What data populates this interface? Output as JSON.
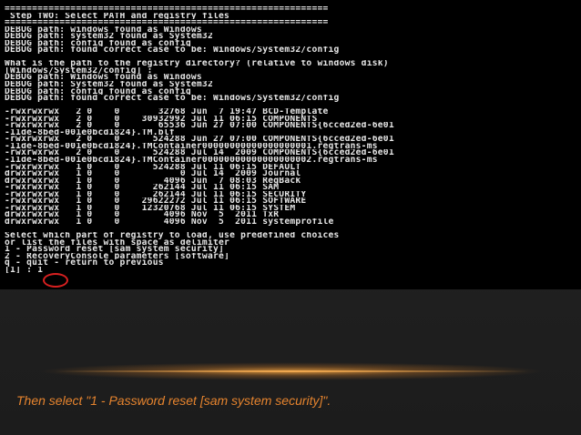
{
  "terminal": {
    "lines": [
      "===========================================================",
      " Step TWO: Select PATH and registry files",
      "===========================================================",
      "DEBUG path: windows found as Windows",
      "DEBUG path: system32 found as System32",
      "DEBUG path: config found as config",
      "DEBUG path: found correct case to be: Windows/System32/config",
      "",
      "What is the path to the registry directory? (relative to windows disk)",
      "[Windows/System32/config] :",
      "DEBUG path: Windows found as Windows",
      "DEBUG path: System32 found as System32",
      "DEBUG path: config found as config",
      "DEBUG path: found correct case to be: Windows/System32/config",
      "",
      "-rwxrwxrwx   2 0    0       32768 Jun  7 19:47 BCD-Template",
      "-rwxrwxrwx   2 0    0    30932992 Jul 11 06:15 COMPONENTS",
      "-rwxrwxrwx   2 0    0       65536 Jun 27 07:00 COMPONENTS{6cced2ed-6e01",
      "-11de-8bed-001e0bcd1824}.TM.blf",
      "-rwxrwxrwx   2 0    0      524288 Jun 27 07:00 COMPONENTS{6cced2ed-6e01",
      "-11de-8bed-001e0bcd1824}.TMContainer00000000000000000001.regtrans-ms",
      "-rwxrwxrwx   2 0    0      524288 Jul 14  2009 COMPONENTS{6cced2ed-6e01",
      "-11de-8bed-001e0bcd1824}.TMContainer00000000000000000002.regtrans-ms",
      "-rwxrwxrwx   1 0    0      524288 Jul 11 06:15 DEFAULT",
      "drwxrwxrwx   1 0    0           0 Jul 14  2009 Journal",
      "drwxrwxrwx   1 0    0        4096 Jun  7 08:03 RegBack",
      "-rwxrwxrwx   1 0    0      262144 Jul 11 06:15 SAM",
      "-rwxrwxrwx   1 0    0      262144 Jul 11 06:15 SECURITY",
      "-rwxrwxrwx   1 0    0    29622272 Jul 11 06:15 SOFTWARE",
      "-rwxrwxrwx   1 0    0    12320768 Jul 11 06:15 SYSTEM",
      "drwxrwxrwx   1 0    0        4096 Nov  5  2011 TxR",
      "drwxrwxrwx   1 0    0        4096 Nov  5  2011 systemprofile",
      "",
      "Select which part of registry to load, use predefined choices",
      "or list the files with space as delimiter",
      "1 - Password reset [sam system security]",
      "2 - RecoveryConsole parameters [software]",
      "q - quit - return to previous",
      "[1] : 1_"
    ]
  },
  "caption": "Then select \"1 - Password reset [sam system security]\".",
  "colors": {
    "terminal_text": "#e6e6e6",
    "caption": "#e6842e",
    "highlight_circle": "#d82020"
  }
}
